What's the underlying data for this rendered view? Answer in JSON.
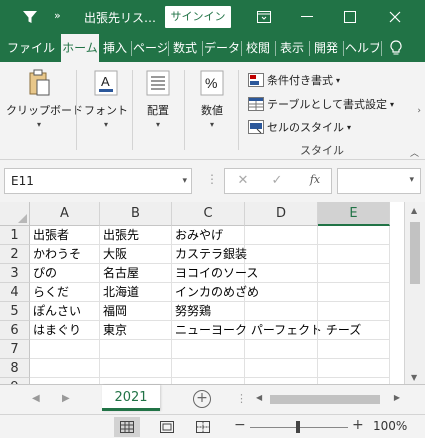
{
  "titlebar": {
    "title": "出張先リス…",
    "more": "»",
    "signin": "サインイン"
  },
  "tabs": [
    {
      "label": "ファイル",
      "active": false
    },
    {
      "label": "ホーム",
      "active": true
    },
    {
      "label": "挿入",
      "active": false
    },
    {
      "label": "ページ",
      "active": false
    },
    {
      "label": "数式",
      "active": false
    },
    {
      "label": "データ",
      "active": false
    },
    {
      "label": "校閲",
      "active": false
    },
    {
      "label": "表示",
      "active": false
    },
    {
      "label": "開発",
      "active": false
    },
    {
      "label": "ヘルプ",
      "active": false
    }
  ],
  "ribbon": {
    "clipboard": "クリップボード",
    "font": "フォント",
    "alignment": "配置",
    "number": "数値",
    "conditional_format": "条件付き書式",
    "format_as_table": "テーブルとして書式設定",
    "cell_styles": "セルのスタイル",
    "styles_group": "スタイル"
  },
  "formula_bar": {
    "name_box": "E11",
    "fx": "fx",
    "value": ""
  },
  "columns": [
    "A",
    "B",
    "C",
    "D",
    "E"
  ],
  "selected_column": "E",
  "rows": [
    {
      "num": "1",
      "cells": [
        "出張者",
        "出張先",
        "おみやげ",
        "",
        ""
      ]
    },
    {
      "num": "2",
      "cells": [
        "かわうそ",
        "大阪",
        "カステラ銀装",
        "",
        ""
      ]
    },
    {
      "num": "3",
      "cells": [
        "ぴの",
        "名古屋",
        "ヨコイのソース",
        "",
        ""
      ]
    },
    {
      "num": "4",
      "cells": [
        "らくだ",
        "北海道",
        "インカのめざめ",
        "",
        ""
      ]
    },
    {
      "num": "5",
      "cells": [
        "ぽんさい",
        "福岡",
        "努努鶏",
        "",
        ""
      ]
    },
    {
      "num": "6",
      "cells": [
        "はまぐり",
        "東京",
        "ニューヨーク パーフェクト チーズ",
        "",
        ""
      ]
    },
    {
      "num": "7",
      "cells": [
        "",
        "",
        "",
        "",
        ""
      ]
    },
    {
      "num": "8",
      "cells": [
        "",
        "",
        "",
        "",
        ""
      ]
    },
    {
      "num": "9",
      "cells": [
        "",
        "",
        "",
        "",
        ""
      ]
    }
  ],
  "sheets": [
    {
      "name": "2021",
      "active": true
    }
  ],
  "status": {
    "zoom": "100%",
    "zoom_minus": "−",
    "zoom_plus": "+"
  },
  "colors": {
    "accent": "#217346",
    "selected_header": "#d2d2d2"
  }
}
